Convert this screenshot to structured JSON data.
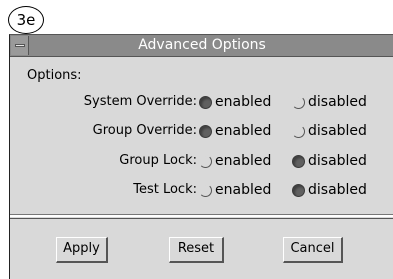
{
  "annotation": "3e",
  "window": {
    "title": "Advanced Options"
  },
  "options_label": "Options:",
  "options": [
    {
      "label": "System Override:",
      "enabled_label": "enabled",
      "disabled_label": "disabled",
      "selected": "enabled"
    },
    {
      "label": "Group Override:",
      "enabled_label": "enabled",
      "disabled_label": "disabled",
      "selected": "enabled"
    },
    {
      "label": "Group Lock:",
      "enabled_label": "enabled",
      "disabled_label": "disabled",
      "selected": "disabled"
    },
    {
      "label": "Test Lock:",
      "enabled_label": "enabled",
      "disabled_label": "disabled",
      "selected": "disabled"
    }
  ],
  "buttons": {
    "apply": "Apply",
    "reset": "Reset",
    "cancel": "Cancel"
  }
}
